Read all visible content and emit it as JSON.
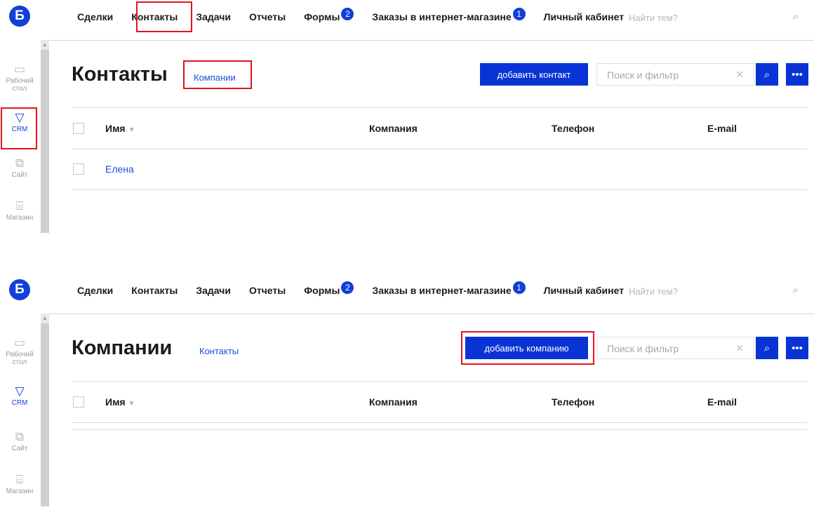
{
  "app": {
    "logo_letter": "Б"
  },
  "nav": [
    {
      "label": "Сделки"
    },
    {
      "label": "Контакты"
    },
    {
      "label": "Задачи"
    },
    {
      "label": "Отчеты"
    },
    {
      "label": "Формы",
      "badge": "2"
    },
    {
      "label": "Заказы в интернет-магазине",
      "badge": "1"
    },
    {
      "label": "Личный кабинет"
    }
  ],
  "top_search": {
    "placeholder": "Найти тем?"
  },
  "sidebar": [
    {
      "label": "Рабочий стол",
      "icon": "desktop-icon"
    },
    {
      "label": "CRM",
      "icon": "funnel-icon",
      "active": true
    },
    {
      "label": "Сайт",
      "icon": "site-icon"
    },
    {
      "label": "Магазин",
      "icon": "store-icon"
    }
  ],
  "panel1": {
    "title": "Контакты",
    "link": "Компании",
    "add_button": "добавить контакт",
    "filter_placeholder": "Поиск и фильтр",
    "columns": [
      "Имя",
      "Компания",
      "Телефон",
      "E-mail"
    ],
    "rows": [
      {
        "name": "Елена"
      }
    ]
  },
  "panel2": {
    "title": "Компании",
    "link": "Контакты",
    "add_button": "добавить компанию",
    "filter_placeholder": "Поиск и фильтр",
    "columns": [
      "Имя",
      "Компания",
      "Телефон",
      "E-mail"
    ],
    "rows": []
  },
  "colors": {
    "accent": "#0a33d6",
    "link": "#1c4fd6",
    "highlight": "#e0141e"
  }
}
